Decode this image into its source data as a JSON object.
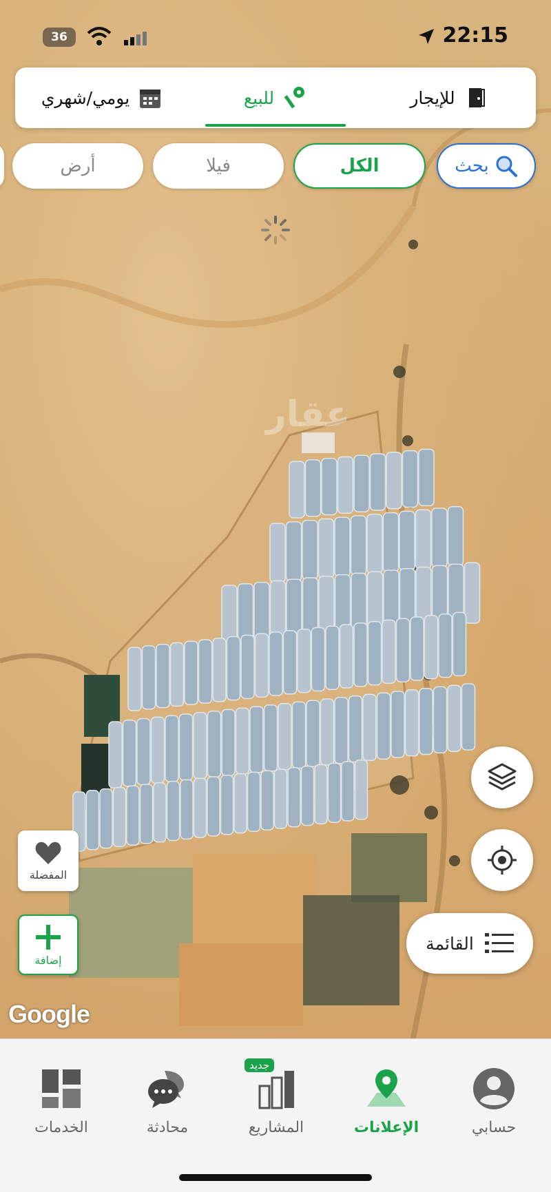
{
  "status": {
    "battery": "36",
    "time": "22:15"
  },
  "tabs": [
    {
      "label": "للإيجار",
      "icon": "door-icon",
      "active": false
    },
    {
      "label": "للبيع",
      "icon": "key-icon",
      "active": true
    },
    {
      "label": "يومي/شهري",
      "icon": "calendar-icon",
      "active": false
    }
  ],
  "filters": {
    "search": "بحث",
    "all": "الكل",
    "villa": "فيلا",
    "land": "أرض"
  },
  "map": {
    "watermark": "عقار",
    "provider": "Google",
    "list_label": "القائمة",
    "favorites_label": "المفضلة",
    "add_label": "إضافة"
  },
  "bottom_nav": [
    {
      "label": "حسابي",
      "icon": "profile-icon",
      "active": false
    },
    {
      "label": "الإعلانات",
      "icon": "map-pin-icon",
      "active": true
    },
    {
      "label": "المشاريع",
      "icon": "buildings-icon",
      "badge": "جديد",
      "active": false
    },
    {
      "label": "محادثة",
      "icon": "chat-icon",
      "active": false
    },
    {
      "label": "الخدمات",
      "icon": "grid-icon",
      "active": false
    }
  ],
  "colors": {
    "accent": "#1aa34a",
    "search": "#2a6fd6"
  }
}
